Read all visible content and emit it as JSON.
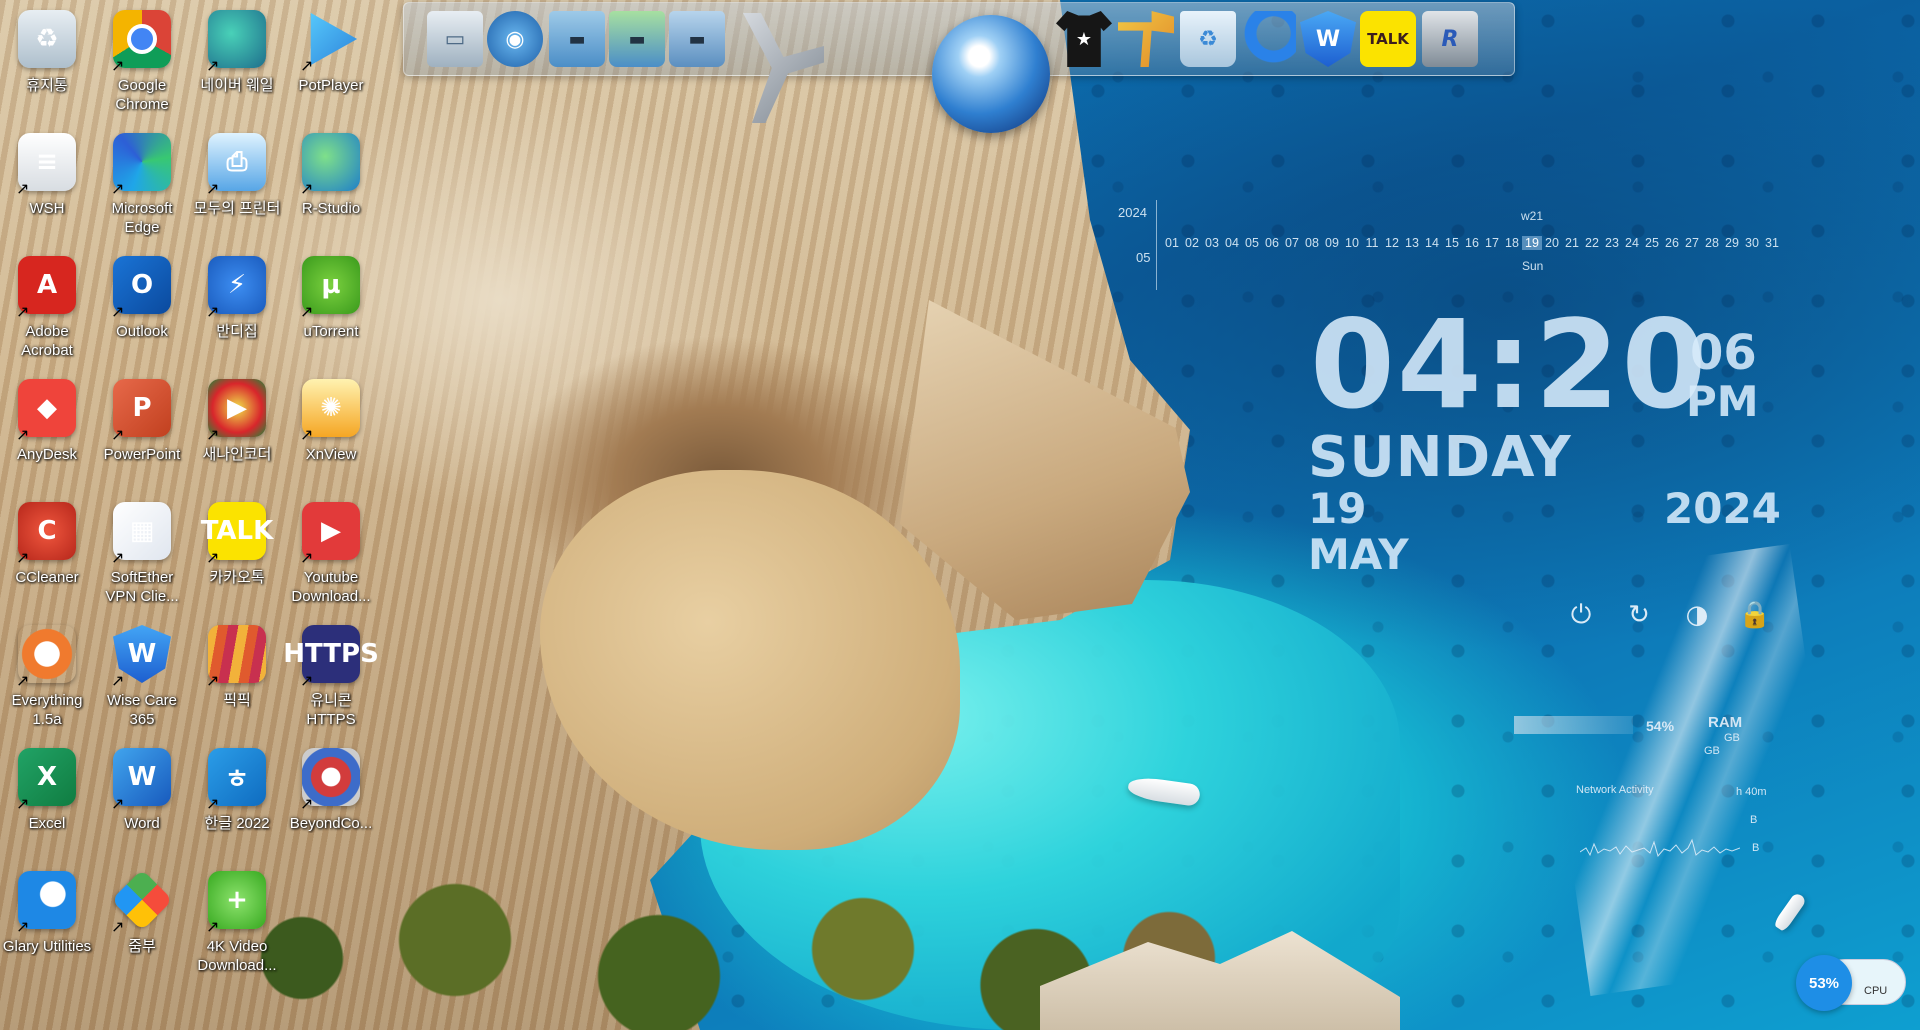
{
  "desktop": {
    "icons": [
      {
        "label": "휴지통",
        "icon": "recycle-bin-icon",
        "glyph": "♻"
      },
      {
        "label": "Google Chrome",
        "icon": "chrome-icon",
        "glyph": ""
      },
      {
        "label": "네이버 웨일",
        "icon": "naver-whale-icon",
        "glyph": ""
      },
      {
        "label": "PotPlayer",
        "icon": "potplayer-icon",
        "glyph": ""
      },
      {
        "label": "WSH",
        "icon": "wsh-file-icon",
        "glyph": "≡"
      },
      {
        "label": "Microsoft Edge",
        "icon": "edge-icon",
        "glyph": ""
      },
      {
        "label": "모두의 프린터",
        "icon": "printer-icon",
        "glyph": "⎙"
      },
      {
        "label": "R-Studio",
        "icon": "r-studio-icon",
        "glyph": ""
      },
      {
        "label": "Adobe Acrobat",
        "icon": "acrobat-icon",
        "glyph": "A"
      },
      {
        "label": "Outlook",
        "icon": "outlook-icon",
        "glyph": "O"
      },
      {
        "label": "반디집",
        "icon": "bandizip-icon",
        "glyph": "⚡"
      },
      {
        "label": "uTorrent",
        "icon": "utorrent-icon",
        "glyph": "µ"
      },
      {
        "label": "AnyDesk",
        "icon": "anydesk-icon",
        "glyph": "◆"
      },
      {
        "label": "PowerPoint",
        "icon": "powerpoint-icon",
        "glyph": "P"
      },
      {
        "label": "새나인코더",
        "icon": "encoder-icon",
        "glyph": "▶"
      },
      {
        "label": "XnView",
        "icon": "xnview-icon",
        "glyph": "✺"
      },
      {
        "label": "CCleaner",
        "icon": "ccleaner-icon",
        "glyph": "C"
      },
      {
        "label": "SoftEther VPN Clie...",
        "icon": "softether-icon",
        "glyph": "▦"
      },
      {
        "label": "카카오톡",
        "icon": "kakaotalk-icon",
        "glyph": "TALK"
      },
      {
        "label": "Youtube Download...",
        "icon": "youtube-downloader-icon",
        "glyph": "▶"
      },
      {
        "label": "Everything 1.5a",
        "icon": "everything-icon",
        "glyph": "○"
      },
      {
        "label": "Wise Care 365",
        "icon": "wise-care-icon",
        "glyph": "W"
      },
      {
        "label": "픽픽",
        "icon": "picpick-icon",
        "glyph": ""
      },
      {
        "label": "유니콘 HTTPS",
        "icon": "unicorn-https-icon",
        "glyph": "HTTPS"
      },
      {
        "label": "Excel",
        "icon": "excel-icon",
        "glyph": "X"
      },
      {
        "label": "Word",
        "icon": "word-icon",
        "glyph": "W"
      },
      {
        "label": "한글 2022",
        "icon": "hangul-icon",
        "glyph": "ㅎ"
      },
      {
        "label": "BeyondCo...",
        "icon": "beyond-compare-icon",
        "glyph": ""
      },
      {
        "label": "Glary Utilities",
        "icon": "glary-utilities-icon",
        "glyph": ""
      },
      {
        "label": "줌부",
        "icon": "zum-icon",
        "glyph": ""
      },
      {
        "label": "4K Video Download...",
        "icon": "4k-video-downloader-icon",
        "glyph": "+"
      }
    ],
    "shortcut_arrow": "↗"
  },
  "dock": {
    "items": [
      {
        "name": "my-computer-icon",
        "glyph": "▭"
      },
      {
        "name": "network-computer-icon",
        "glyph": "◉"
      },
      {
        "name": "documents-folder-icon",
        "glyph": "▬"
      },
      {
        "name": "downloads-folder-icon",
        "glyph": "▬"
      },
      {
        "name": "open-folder-icon",
        "glyph": "▬"
      },
      {
        "name": "tools-icon",
        "glyph": ""
      },
      {
        "name": "internet-globe-icon",
        "glyph": ""
      },
      {
        "name": "tshirt-icon",
        "glyph": "★"
      },
      {
        "name": "hammer-icon",
        "glyph": ""
      },
      {
        "name": "recycle-bin-icon",
        "glyph": "♻"
      },
      {
        "name": "moon-app-icon",
        "glyph": ""
      },
      {
        "name": "wise-shield-icon",
        "glyph": "W"
      },
      {
        "name": "kakaotalk-icon",
        "glyph": "TALK"
      },
      {
        "name": "r-restore-icon",
        "glyph": "R"
      }
    ]
  },
  "calendar": {
    "year": "2024",
    "week": "w21",
    "month": "05",
    "days": [
      "01",
      "02",
      "03",
      "04",
      "05",
      "06",
      "07",
      "08",
      "09",
      "10",
      "11",
      "12",
      "13",
      "14",
      "15",
      "16",
      "17",
      "18",
      "19",
      "20",
      "21",
      "22",
      "23",
      "24",
      "25",
      "26",
      "27",
      "28",
      "29",
      "30",
      "31"
    ],
    "today": "19",
    "today_name": "Sun"
  },
  "clock": {
    "time": "04:20",
    "seconds": "06",
    "ampm": "PM",
    "weekday": "SUNDAY",
    "date": "19 MAY",
    "year": "2024"
  },
  "power_controls": [
    {
      "name": "shutdown-icon",
      "glyph": "⏻"
    },
    {
      "name": "restart-icon",
      "glyph": "↻"
    },
    {
      "name": "sleep-icon",
      "glyph": "◑"
    },
    {
      "name": "lock-icon",
      "glyph": "🔒"
    }
  ],
  "system_monitor": {
    "ram_percent": "54%",
    "ram_label": "RAM",
    "ram_total": "GB",
    "ram_free": "GB",
    "ram_fraction": 0.54,
    "network_title": "Network Activity",
    "uptime": "h 40m",
    "net_value_1": "B",
    "net_value_2": "B",
    "cpu_percent": "53%",
    "cpu_label": "CPU"
  }
}
